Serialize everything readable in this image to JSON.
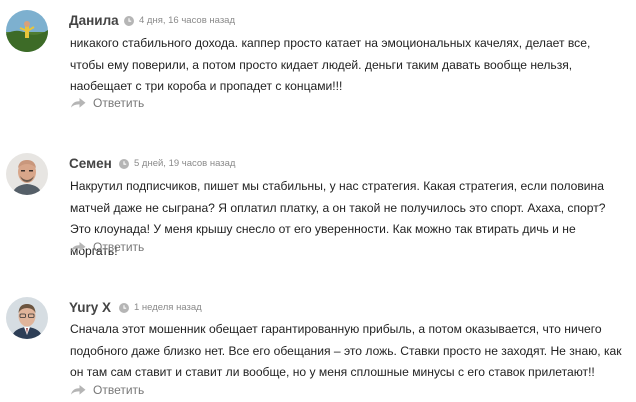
{
  "comments": [
    {
      "author": "Данила",
      "time": "4 дня, 16 часов назад",
      "text": "никакого стабильного дохода. каппер просто катает на эмоциональных качелях, делает все, чтобы ему поверили, а потом просто кидает людей. деньги таким давать вообще нельзя, наобещает с три короба и пропадет с концами!!!",
      "reply_label": "Ответить",
      "avatar_icon": "avatar-landscape"
    },
    {
      "author": "Семен",
      "time": "5 дней, 19 часов назад",
      "text": "Накрутил подписчиков, пишет мы стабильны, у нас стратегия. Какая стратегия, если половина матчей даже не сыграна? Я оплатил платку, а он такой не получилось это спорт. Ахаха, спорт? Это клоунада! У меня крышу снесло от его уверенности. Как можно так втирать дичь и не моргать!",
      "reply_label": "Ответить",
      "avatar_icon": "avatar-bald-man"
    },
    {
      "author": "Yury X",
      "time": "1 неделя назад",
      "text": "Сначала этот мошенник обещает гарантированную прибыль, а потом оказывается, что ничего подобного даже близко нет. Все его обещания – это ложь. Ставки просто не заходят. Не знаю, как он там сам ставит и ставит ли вообще, но у меня сплошные минусы с его ставок прилетают!!",
      "reply_label": "Ответить",
      "avatar_icon": "avatar-man-in-suit"
    }
  ],
  "colors": {
    "text": "#222222",
    "author": "#444444",
    "meta": "#8a8a8a",
    "reply": "#777777",
    "icon": "#b5b5b5"
  }
}
